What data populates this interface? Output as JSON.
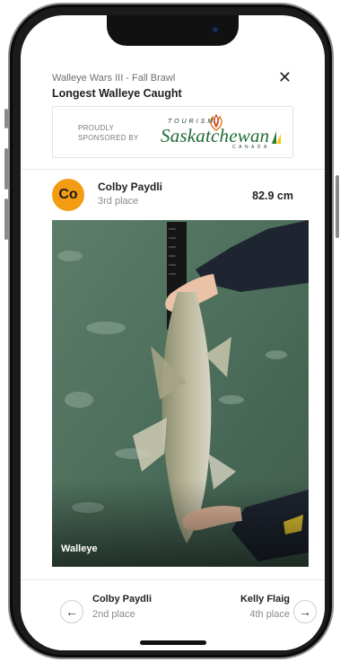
{
  "header": {
    "event": "Walleye Wars III - Fall Brawl",
    "category": "Longest Walleye Caught",
    "close_icon": "close-icon"
  },
  "sponsor": {
    "line1": "PROUDLY",
    "line2": "SPONSORED BY",
    "logo_top": "TOURISM",
    "logo_main": "Saskatchewan",
    "logo_bottom": "CANADA"
  },
  "entry": {
    "initials": "Co",
    "name": "Colby Paydli",
    "place": "3rd place",
    "length": "82.9 cm",
    "avatar_color": "#f39c12"
  },
  "photo": {
    "species_label": "Walleye"
  },
  "navigation": {
    "prev": {
      "name": "Colby Paydli",
      "place": "2nd place",
      "icon": "arrow-left-icon"
    },
    "next": {
      "name": "Kelly Flaig",
      "place": "4th place",
      "icon": "arrow-right-icon"
    }
  }
}
